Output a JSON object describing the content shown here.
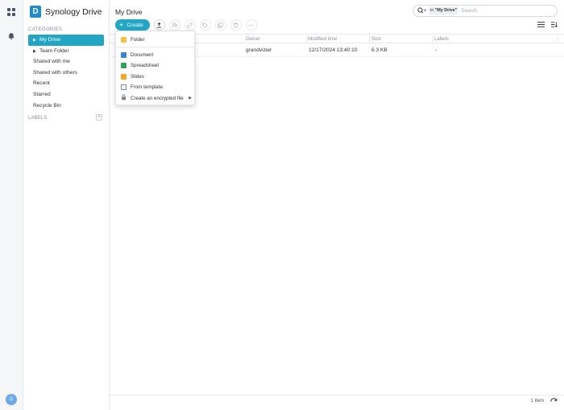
{
  "app": {
    "name": "Synology Drive",
    "logo_letter": "D",
    "brand_color": "#1e8ccf",
    "accent_color": "#23a6c4"
  },
  "rail": {
    "avatar_letter": "G"
  },
  "sidebar": {
    "categories_label": "CATEGORIES",
    "items": [
      {
        "label": "My Drive",
        "active": true,
        "expandable": true
      },
      {
        "label": "Team Folder",
        "active": false,
        "expandable": true
      },
      {
        "label": "Shared with me"
      },
      {
        "label": "Shared with others"
      },
      {
        "label": "Recent"
      },
      {
        "label": "Starred"
      },
      {
        "label": "Recycle Bin"
      }
    ],
    "labels_label": "LABELS"
  },
  "header": {
    "title": "My Drive"
  },
  "search": {
    "scope_prefix": "in",
    "scope_value": "\"My Drive\"",
    "placeholder": "Search"
  },
  "toolbar": {
    "create_label": "Create"
  },
  "table": {
    "columns": [
      "Owner",
      "Modified time",
      "Size",
      "Labels"
    ],
    "rows": [
      {
        "owner": "grandvizier",
        "modified": "12/17/2024 13:40:10",
        "size": "6.3 KB",
        "labels": "-"
      }
    ]
  },
  "create_menu": {
    "items": [
      {
        "label": "Folder",
        "icon": "folder-icon"
      },
      {
        "label": "Document",
        "icon": "document-icon"
      },
      {
        "label": "Spreadsheet",
        "icon": "spreadsheet-icon"
      },
      {
        "label": "Slides",
        "icon": "slides-icon"
      },
      {
        "label": "From template",
        "icon": "template-icon"
      },
      {
        "label": "Create an encrypted file",
        "icon": "lock-icon"
      }
    ]
  },
  "footer": {
    "item_count": "1 item"
  }
}
